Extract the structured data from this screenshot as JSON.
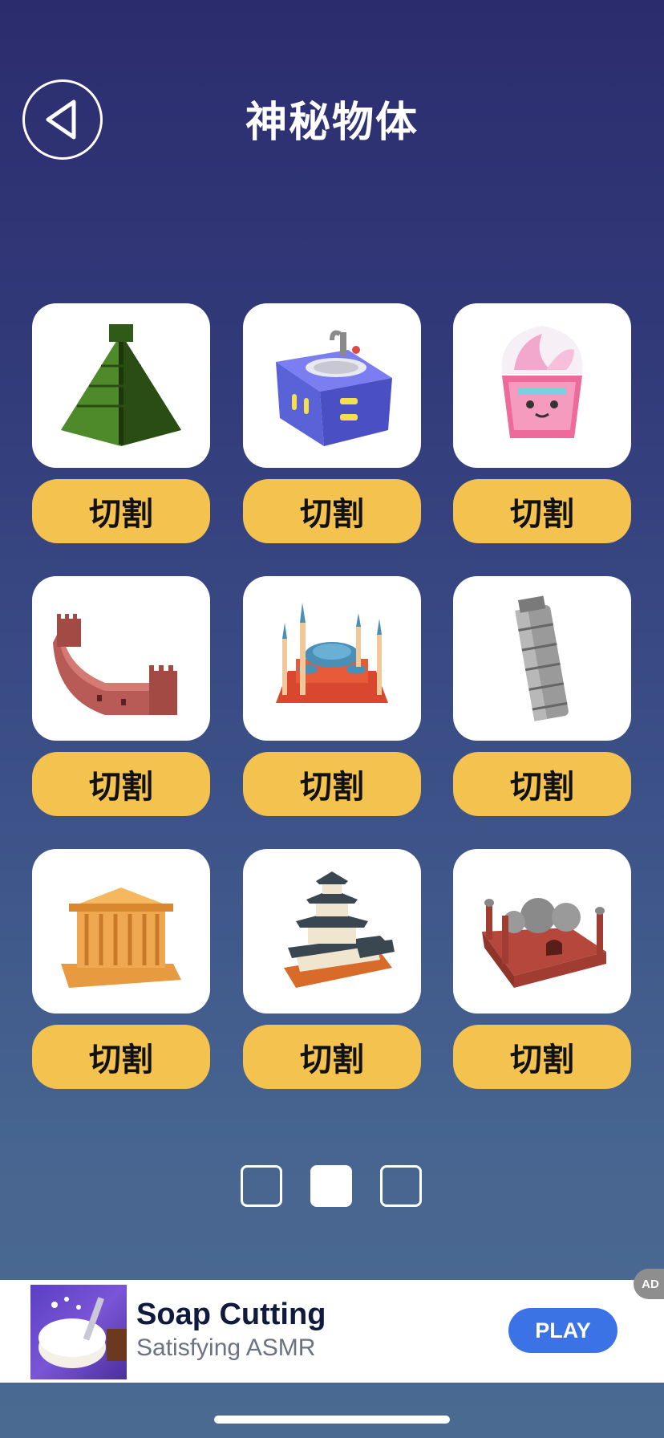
{
  "header": {
    "title": "神秘物体",
    "back_icon": "back-triangle-icon"
  },
  "items": [
    {
      "name": "pyramid",
      "icon": "pyramid-icon",
      "button_label": "切割"
    },
    {
      "name": "sink-cabinet",
      "icon": "sink-cabinet-icon",
      "button_label": "切割"
    },
    {
      "name": "ice-cream-cup",
      "icon": "ice-cream-cup-icon",
      "button_label": "切割"
    },
    {
      "name": "great-wall",
      "icon": "great-wall-icon",
      "button_label": "切割"
    },
    {
      "name": "mosque",
      "icon": "mosque-icon",
      "button_label": "切割"
    },
    {
      "name": "leaning-tower",
      "icon": "leaning-tower-icon",
      "button_label": "切割"
    },
    {
      "name": "greek-temple",
      "icon": "greek-temple-icon",
      "button_label": "切割"
    },
    {
      "name": "japanese-castle",
      "icon": "japanese-castle-icon",
      "button_label": "切割"
    },
    {
      "name": "red-fort-mosque",
      "icon": "red-fort-mosque-icon",
      "button_label": "切割"
    }
  ],
  "pagination": {
    "total": 3,
    "current": 2
  },
  "ad": {
    "title": "Soap Cutting",
    "subtitle": "Satisfying ASMR",
    "play_label": "PLAY",
    "badge": "AD"
  },
  "colors": {
    "button_yellow": "#f4c24e",
    "background_top": "#2b2c6e",
    "background_bottom": "#4b6a92",
    "ad_play_blue": "#3b73e6"
  }
}
